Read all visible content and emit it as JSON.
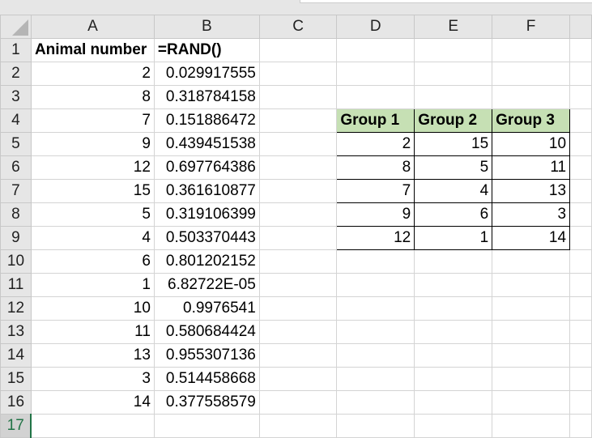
{
  "columns": [
    "A",
    "B",
    "C",
    "D",
    "E",
    "F"
  ],
  "rows": [
    "1",
    "2",
    "3",
    "4",
    "5",
    "6",
    "7",
    "8",
    "9",
    "10",
    "11",
    "12",
    "13",
    "14",
    "15",
    "16",
    "17"
  ],
  "headers": {
    "a1": "Animal number",
    "b1": "=RAND()"
  },
  "animal_numbers": [
    "2",
    "8",
    "7",
    "9",
    "12",
    "15",
    "5",
    "4",
    "6",
    "1",
    "10",
    "11",
    "13",
    "3",
    "14"
  ],
  "rand_values": [
    "0.029917555",
    "0.318784158",
    "0.151886472",
    "0.439451538",
    "0.697764386",
    "0.361610877",
    "0.319106399",
    "0.503370443",
    "0.801202152",
    "6.82722E-05",
    "0.9976541",
    "0.580684424",
    "0.955307136",
    "0.514458668",
    "0.377558579"
  ],
  "groups": {
    "headers": [
      "Group 1",
      "Group 2",
      "Group 3"
    ],
    "rows": [
      [
        "2",
        "15",
        "10"
      ],
      [
        "8",
        "5",
        "11"
      ],
      [
        "7",
        "4",
        "13"
      ],
      [
        "9",
        "6",
        "3"
      ],
      [
        "12",
        "1",
        "14"
      ]
    ]
  }
}
